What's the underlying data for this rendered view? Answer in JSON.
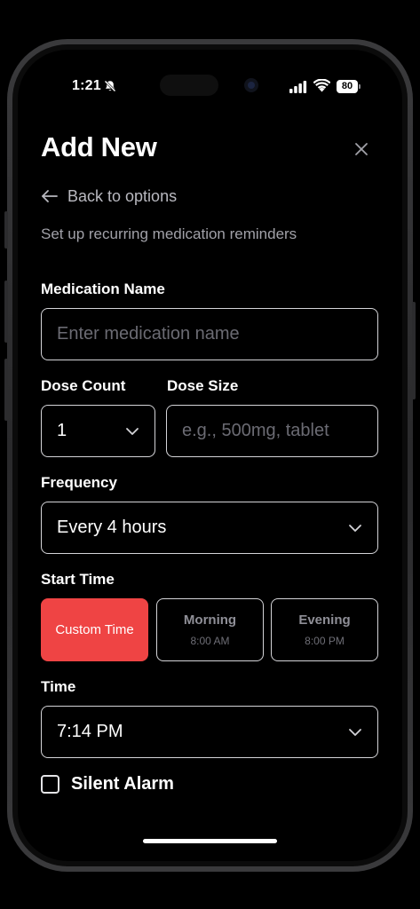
{
  "status_bar": {
    "time": "1:21",
    "battery": "80"
  },
  "header": {
    "title": "Add New",
    "back_label": "Back to options",
    "subtitle": "Set up recurring medication reminders"
  },
  "form": {
    "medication_name": {
      "label": "Medication Name",
      "value": "",
      "placeholder": "Enter medication name"
    },
    "dose_count": {
      "label": "Dose Count",
      "value": "1"
    },
    "dose_size": {
      "label": "Dose Size",
      "value": "",
      "placeholder": "e.g., 500mg, tablet"
    },
    "frequency": {
      "label": "Frequency",
      "value": "Every 4 hours"
    },
    "start_time": {
      "label": "Start Time",
      "options": [
        {
          "name": "Custom Time",
          "time": "",
          "selected": true
        },
        {
          "name": "Morning",
          "time": "8:00 AM",
          "selected": false
        },
        {
          "name": "Evening",
          "time": "8:00 PM",
          "selected": false
        }
      ]
    },
    "time": {
      "label": "Time",
      "value": "7:14 PM"
    },
    "silent_alarm": {
      "label": "Silent Alarm",
      "checked": false
    }
  },
  "colors": {
    "accent": "#ef4444",
    "background": "#000000",
    "border": "#d4d4d8",
    "muted_text": "#a1a1a8"
  },
  "icons": [
    "bell-slash-icon",
    "signal-icon",
    "wifi-icon",
    "battery-icon",
    "close-icon",
    "arrow-left-icon",
    "chevron-down-icon"
  ]
}
